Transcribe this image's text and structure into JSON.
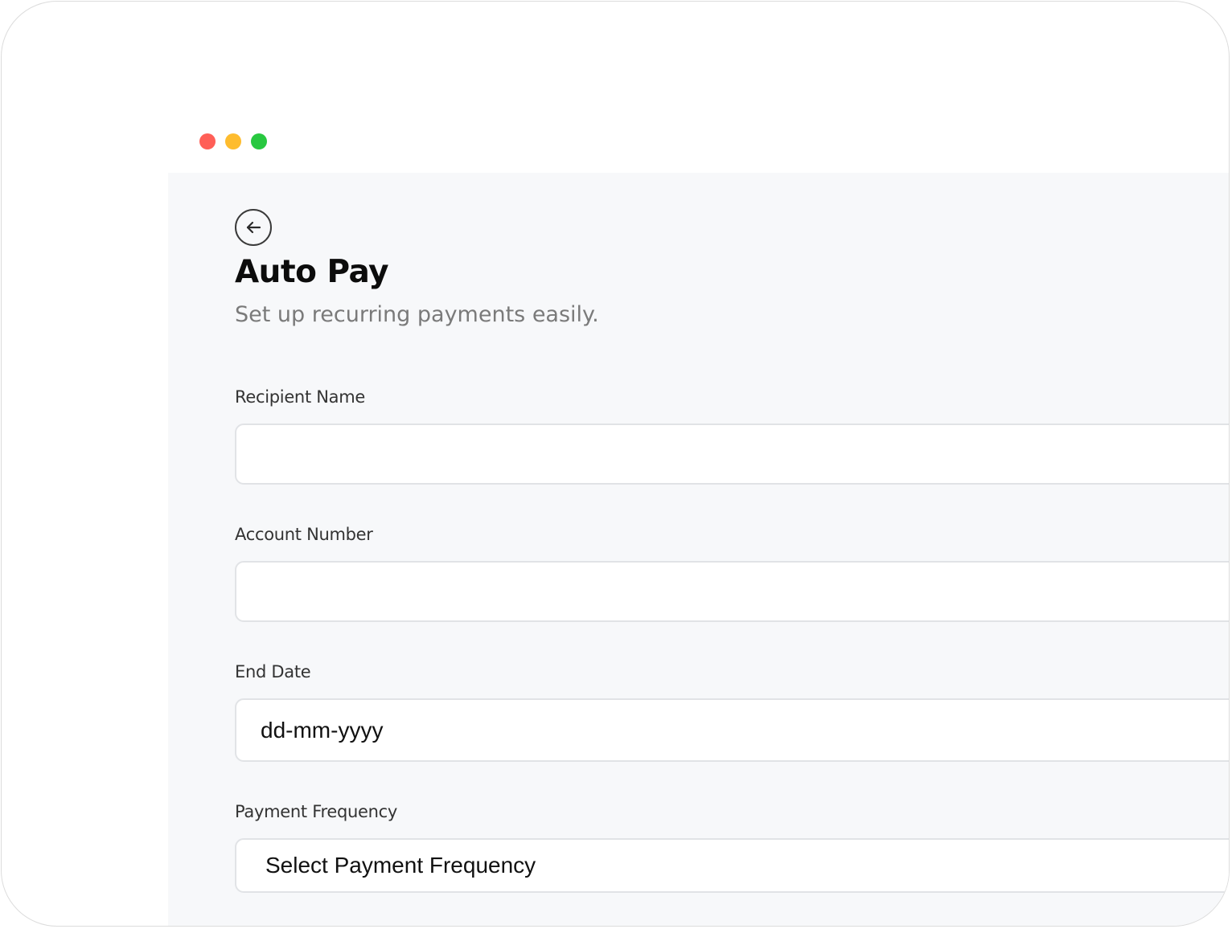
{
  "window": {
    "controls": [
      {
        "name": "close",
        "color": "#ff5f57"
      },
      {
        "name": "minimize",
        "color": "#febc2e"
      },
      {
        "name": "maximize",
        "color": "#28c840"
      }
    ]
  },
  "header": {
    "back_icon": "arrow-left-icon",
    "title": "Auto Pay",
    "subtitle": "Set up recurring payments easily."
  },
  "form": {
    "recipient_name": {
      "label": "Recipient Name",
      "value": ""
    },
    "account_number": {
      "label": "Account Number",
      "value": ""
    },
    "end_date": {
      "label": "End Date",
      "placeholder": "dd-mm-yyyy"
    },
    "payment_frequency": {
      "label": "Payment Frequency",
      "selected": "Select Payment Frequency"
    }
  },
  "colors": {
    "panel_background": "#f7f8fa",
    "field_border": "#e1e3e6",
    "title": "#0c0c0c",
    "subtitle": "#7a7a7a"
  }
}
